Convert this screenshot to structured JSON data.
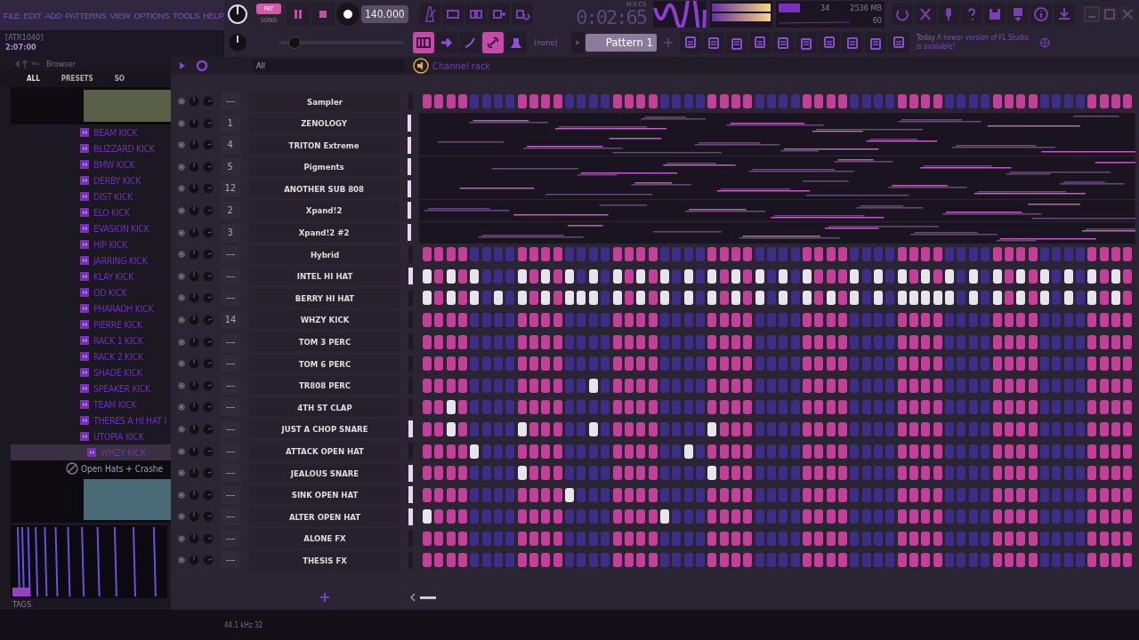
{
  "menu": [
    "FILE",
    "EDIT",
    "ADD",
    "PATTERNS",
    "VIEW",
    "OPTIONS",
    "TOOLS",
    "HELP"
  ],
  "hint": {
    "title": "[ATR1040]",
    "value": "2:07:00"
  },
  "transport": {
    "modes": [
      {
        "label": "PAT",
        "selected": true
      },
      {
        "label": "SONG",
        "selected": false
      }
    ],
    "tempo": "140.000",
    "time_unit": "M:S:CS",
    "time": "0:02:65"
  },
  "monitor": {
    "cpu": "34",
    "memory": "2536 MB",
    "polyphony": "60"
  },
  "pattern": {
    "channel": "(none)",
    "name": "Pattern 1"
  },
  "pitch": {
    "level": 0.12
  },
  "news": {
    "date": "Today",
    "text": "A newer version of FL Studio is available!"
  },
  "browser": {
    "title": "Browser",
    "tabs": [
      {
        "label": "ALL",
        "selected": true
      },
      {
        "label": "PRESETS",
        "selected": false
      },
      {
        "label": "SO",
        "selected": false
      }
    ],
    "items": [
      {
        "label": "BEAM KICK",
        "selected": false
      },
      {
        "label": "BLIZZARD KICK",
        "selected": false
      },
      {
        "label": "BMW KICK",
        "selected": false
      },
      {
        "label": "DERBY KICK",
        "selected": false
      },
      {
        "label": "DIST KICK",
        "selected": false
      },
      {
        "label": "ELO KICK",
        "selected": false
      },
      {
        "label": "EVASION KICK",
        "selected": false
      },
      {
        "label": "HIP KICK",
        "selected": false
      },
      {
        "label": "JARRING KICK",
        "selected": false
      },
      {
        "label": "KLAY KICK",
        "selected": false
      },
      {
        "label": "OD KICK",
        "selected": false
      },
      {
        "label": "PHARAOH KICK",
        "selected": false
      },
      {
        "label": "PIERRE KICK",
        "selected": false
      },
      {
        "label": "RACK 1 KICK",
        "selected": false
      },
      {
        "label": "RACK 2 KICK",
        "selected": false
      },
      {
        "label": "SHADE KICK",
        "selected": false
      },
      {
        "label": "SPEAKER KICK",
        "selected": false
      },
      {
        "label": "TEAM KICK",
        "selected": false
      },
      {
        "label": "THERES A HI HAT I",
        "selected": false
      },
      {
        "label": "UTOPIA KICK",
        "selected": false
      },
      {
        "label": "WHZY KICK",
        "selected": true
      }
    ],
    "folder": "Open Hats + Crashe",
    "sample_rate": "44.1 kHz 32",
    "tags": "TAGS"
  },
  "channel_rack": {
    "title": "Channel rack",
    "filter": "All",
    "channels": [
      {
        "track": "---",
        "name": "Sampler",
        "selected": false,
        "kind": "steps",
        "steps": [
          false,
          false,
          false,
          false,
          false,
          false,
          false,
          false,
          false,
          false,
          false,
          false,
          false,
          false,
          false,
          false,
          false,
          false,
          false,
          false,
          false,
          false,
          false,
          false,
          false,
          false,
          false,
          false,
          false,
          false,
          false,
          false,
          false,
          false,
          false,
          false,
          false,
          false,
          false,
          false,
          false,
          false,
          false,
          false,
          false,
          false,
          false,
          false,
          false,
          false,
          false,
          false,
          false,
          false,
          false,
          false,
          false,
          false,
          false,
          false
        ]
      },
      {
        "track": "1",
        "name": "ZENOLOGY",
        "selected": true,
        "kind": "roll"
      },
      {
        "track": "4",
        "name": "TRITON Extreme",
        "selected": true,
        "kind": "roll"
      },
      {
        "track": "5",
        "name": "Pigments",
        "selected": true,
        "kind": "roll"
      },
      {
        "track": "12",
        "name": "ANOTHER SUB 808",
        "selected": true,
        "kind": "roll"
      },
      {
        "track": "2",
        "name": "Xpand!2",
        "selected": true,
        "kind": "roll"
      },
      {
        "track": "3",
        "name": "Xpand!2 #2",
        "selected": true,
        "kind": "roll"
      },
      {
        "track": "---",
        "name": "Hybrid",
        "selected": false,
        "kind": "steps",
        "steps": [
          false,
          false,
          false,
          false,
          false,
          false,
          false,
          false,
          false,
          false,
          false,
          false,
          false,
          false,
          false,
          false,
          false,
          false,
          false,
          false,
          false,
          false,
          false,
          false,
          false,
          false,
          false,
          false,
          false,
          false,
          false,
          false,
          false,
          false,
          false,
          false,
          false,
          false,
          false,
          false,
          false,
          false,
          false,
          false,
          false,
          false,
          false,
          false,
          false,
          false,
          false,
          false,
          false,
          false,
          false,
          false,
          false,
          false,
          false,
          false
        ]
      },
      {
        "track": "---",
        "name": "INTEL HI HAT",
        "selected": true,
        "kind": "steps",
        "steps": [
          true,
          false,
          true,
          false,
          true,
          false,
          false,
          false,
          true,
          false,
          true,
          false,
          true,
          false,
          true,
          false,
          true,
          false,
          true,
          false,
          true,
          false,
          true,
          false,
          true,
          false,
          true,
          false,
          true,
          false,
          true,
          false,
          true,
          false,
          false,
          false,
          true,
          false,
          true,
          false,
          true,
          false,
          true,
          false,
          true,
          false,
          true,
          false,
          true,
          false,
          true,
          false,
          true,
          false,
          true,
          false,
          true,
          false,
          true,
          false
        ]
      },
      {
        "track": "---",
        "name": "BERRY HI HAT",
        "selected": false,
        "kind": "steps",
        "steps": [
          true,
          false,
          true,
          false,
          true,
          false,
          true,
          false,
          true,
          false,
          true,
          false,
          true,
          true,
          true,
          false,
          true,
          false,
          true,
          false,
          true,
          false,
          true,
          false,
          true,
          false,
          true,
          false,
          true,
          false,
          true,
          false,
          true,
          false,
          true,
          false,
          true,
          false,
          true,
          false,
          true,
          true,
          true,
          true,
          true,
          false,
          true,
          false,
          true,
          false,
          true,
          false,
          true,
          false,
          true,
          false,
          true,
          false,
          true,
          false
        ]
      },
      {
        "track": "14",
        "name": "WHZY KICK",
        "selected": false,
        "kind": "steps",
        "steps": [
          false,
          false,
          false,
          false,
          false,
          false,
          false,
          false,
          false,
          false,
          false,
          false,
          false,
          false,
          false,
          false,
          false,
          false,
          false,
          false,
          false,
          false,
          false,
          false,
          false,
          false,
          false,
          false,
          false,
          false,
          false,
          false,
          false,
          false,
          false,
          false,
          false,
          false,
          false,
          false,
          false,
          false,
          false,
          false,
          false,
          false,
          false,
          false,
          false,
          false,
          false,
          false,
          false,
          false,
          false,
          false,
          false,
          false,
          false,
          false
        ]
      },
      {
        "track": "---",
        "name": "TOM 3 PERC",
        "selected": false,
        "kind": "steps",
        "steps": [
          false,
          false,
          false,
          false,
          false,
          false,
          false,
          false,
          false,
          false,
          false,
          false,
          false,
          false,
          false,
          false,
          false,
          false,
          false,
          false,
          false,
          false,
          false,
          false,
          false,
          false,
          false,
          false,
          false,
          false,
          false,
          false,
          false,
          false,
          false,
          false,
          false,
          false,
          false,
          false,
          false,
          false,
          false,
          false,
          false,
          false,
          false,
          false,
          false,
          false,
          false,
          false,
          false,
          false,
          false,
          false,
          false,
          false,
          false,
          false
        ]
      },
      {
        "track": "---",
        "name": "TOM 6 PERC",
        "selected": false,
        "kind": "steps",
        "steps": [
          false,
          false,
          false,
          false,
          false,
          false,
          false,
          false,
          false,
          false,
          false,
          false,
          false,
          false,
          false,
          false,
          false,
          false,
          false,
          false,
          false,
          false,
          false,
          false,
          false,
          false,
          false,
          false,
          false,
          false,
          false,
          false,
          false,
          false,
          false,
          false,
          false,
          false,
          false,
          false,
          false,
          false,
          false,
          false,
          false,
          false,
          false,
          false,
          false,
          false,
          false,
          false,
          false,
          false,
          false,
          false,
          false,
          false,
          false,
          false
        ]
      },
      {
        "track": "---",
        "name": "TR808 PERC",
        "selected": false,
        "kind": "steps",
        "steps": [
          false,
          false,
          false,
          false,
          false,
          false,
          false,
          false,
          false,
          false,
          false,
          false,
          false,
          false,
          true,
          false,
          false,
          false,
          false,
          false,
          false,
          false,
          false,
          false,
          false,
          false,
          false,
          false,
          false,
          false,
          false,
          false,
          false,
          false,
          false,
          false,
          false,
          false,
          false,
          false,
          false,
          false,
          false,
          false,
          false,
          false,
          false,
          false,
          false,
          false,
          false,
          false,
          false,
          false,
          false,
          false,
          false,
          false,
          false,
          false
        ]
      },
      {
        "track": "---",
        "name": "4TH ST CLAP",
        "selected": false,
        "kind": "steps",
        "steps": [
          false,
          false,
          true,
          false,
          false,
          false,
          false,
          false,
          false,
          false,
          false,
          false,
          false,
          false,
          false,
          false,
          false,
          false,
          false,
          false,
          false,
          false,
          false,
          false,
          false,
          false,
          false,
          false,
          false,
          false,
          false,
          false,
          false,
          false,
          false,
          false,
          false,
          false,
          false,
          false,
          false,
          false,
          false,
          false,
          false,
          false,
          false,
          false,
          false,
          false,
          false,
          false,
          false,
          false,
          false,
          false,
          false,
          false,
          false,
          false
        ]
      },
      {
        "track": "---",
        "name": "JUST A CHOP SNARE",
        "selected": true,
        "kind": "steps",
        "steps": [
          false,
          false,
          true,
          false,
          false,
          false,
          false,
          false,
          true,
          false,
          false,
          false,
          false,
          false,
          true,
          false,
          false,
          false,
          false,
          false,
          false,
          false,
          false,
          false,
          true,
          false,
          false,
          false,
          false,
          false,
          false,
          false,
          false,
          false,
          false,
          false,
          false,
          false,
          false,
          false,
          false,
          false,
          false,
          false,
          false,
          false,
          false,
          false,
          false,
          false,
          false,
          false,
          false,
          false,
          false,
          false,
          false,
          false,
          false,
          false
        ]
      },
      {
        "track": "---",
        "name": "ATTACK OPEN HAT",
        "selected": false,
        "kind": "steps",
        "steps": [
          false,
          false,
          false,
          false,
          true,
          false,
          false,
          false,
          false,
          false,
          false,
          false,
          false,
          false,
          false,
          false,
          false,
          false,
          false,
          false,
          false,
          false,
          true,
          false,
          false,
          false,
          false,
          false,
          false,
          false,
          false,
          false,
          false,
          false,
          false,
          false,
          false,
          false,
          false,
          false,
          false,
          false,
          false,
          false,
          false,
          false,
          false,
          false,
          false,
          false,
          false,
          false,
          false,
          false,
          false,
          false,
          false,
          false,
          false,
          false
        ]
      },
      {
        "track": "---",
        "name": "JEALOUS SNARE",
        "selected": true,
        "kind": "steps",
        "steps": [
          false,
          false,
          false,
          false,
          false,
          false,
          false,
          false,
          true,
          false,
          false,
          false,
          false,
          false,
          false,
          false,
          false,
          false,
          false,
          false,
          false,
          false,
          false,
          false,
          true,
          false,
          false,
          false,
          false,
          false,
          false,
          false,
          false,
          false,
          false,
          false,
          false,
          false,
          false,
          false,
          false,
          false,
          false,
          false,
          false,
          false,
          false,
          false,
          false,
          false,
          false,
          false,
          false,
          false,
          false,
          false,
          false,
          false,
          false,
          false
        ]
      },
      {
        "track": "---",
        "name": "SINK OPEN HAT",
        "selected": true,
        "kind": "steps",
        "steps": [
          false,
          false,
          false,
          false,
          false,
          false,
          false,
          false,
          false,
          false,
          false,
          false,
          true,
          false,
          false,
          false,
          false,
          false,
          false,
          false,
          false,
          false,
          false,
          false,
          false,
          false,
          false,
          false,
          false,
          false,
          false,
          false,
          false,
          false,
          false,
          false,
          false,
          false,
          false,
          false,
          false,
          false,
          false,
          false,
          false,
          false,
          false,
          false,
          false,
          false,
          false,
          false,
          false,
          false,
          false,
          false,
          false,
          false,
          false,
          false
        ]
      },
      {
        "track": "---",
        "name": "ALTER OPEN HAT",
        "selected": true,
        "kind": "steps",
        "steps": [
          true,
          false,
          false,
          false,
          false,
          false,
          false,
          false,
          false,
          false,
          false,
          false,
          false,
          false,
          false,
          false,
          false,
          false,
          false,
          false,
          true,
          false,
          false,
          false,
          false,
          false,
          false,
          false,
          false,
          false,
          false,
          false,
          false,
          false,
          false,
          false,
          false,
          false,
          false,
          false,
          false,
          false,
          false,
          false,
          false,
          false,
          false,
          false,
          false,
          false,
          false,
          false,
          false,
          false,
          false,
          false,
          false,
          false,
          false,
          false
        ]
      },
      {
        "track": "---",
        "name": "ALONE FX",
        "selected": false,
        "kind": "steps",
        "steps": [
          false,
          false,
          false,
          false,
          false,
          false,
          false,
          false,
          false,
          false,
          false,
          false,
          false,
          false,
          false,
          false,
          false,
          false,
          false,
          false,
          false,
          false,
          false,
          false,
          false,
          false,
          false,
          false,
          false,
          false,
          false,
          false,
          false,
          false,
          false,
          false,
          false,
          false,
          false,
          false,
          false,
          false,
          false,
          false,
          false,
          false,
          false,
          false,
          false,
          false,
          false,
          false,
          false,
          false,
          false,
          false,
          false,
          false,
          false,
          false
        ]
      },
      {
        "track": "---",
        "name": "THESIS FX",
        "selected": false,
        "kind": "steps",
        "steps": [
          false,
          false,
          false,
          false,
          false,
          false,
          false,
          false,
          false,
          false,
          false,
          false,
          false,
          false,
          false,
          false,
          false,
          false,
          false,
          false,
          false,
          false,
          false,
          false,
          false,
          false,
          false,
          false,
          false,
          false,
          false,
          false,
          false,
          false,
          false,
          false,
          false,
          false,
          false,
          false,
          false,
          false,
          false,
          false,
          false,
          false,
          false,
          false,
          false,
          false,
          false,
          false,
          false,
          false,
          false,
          false,
          false,
          false,
          false,
          false
        ]
      }
    ]
  }
}
